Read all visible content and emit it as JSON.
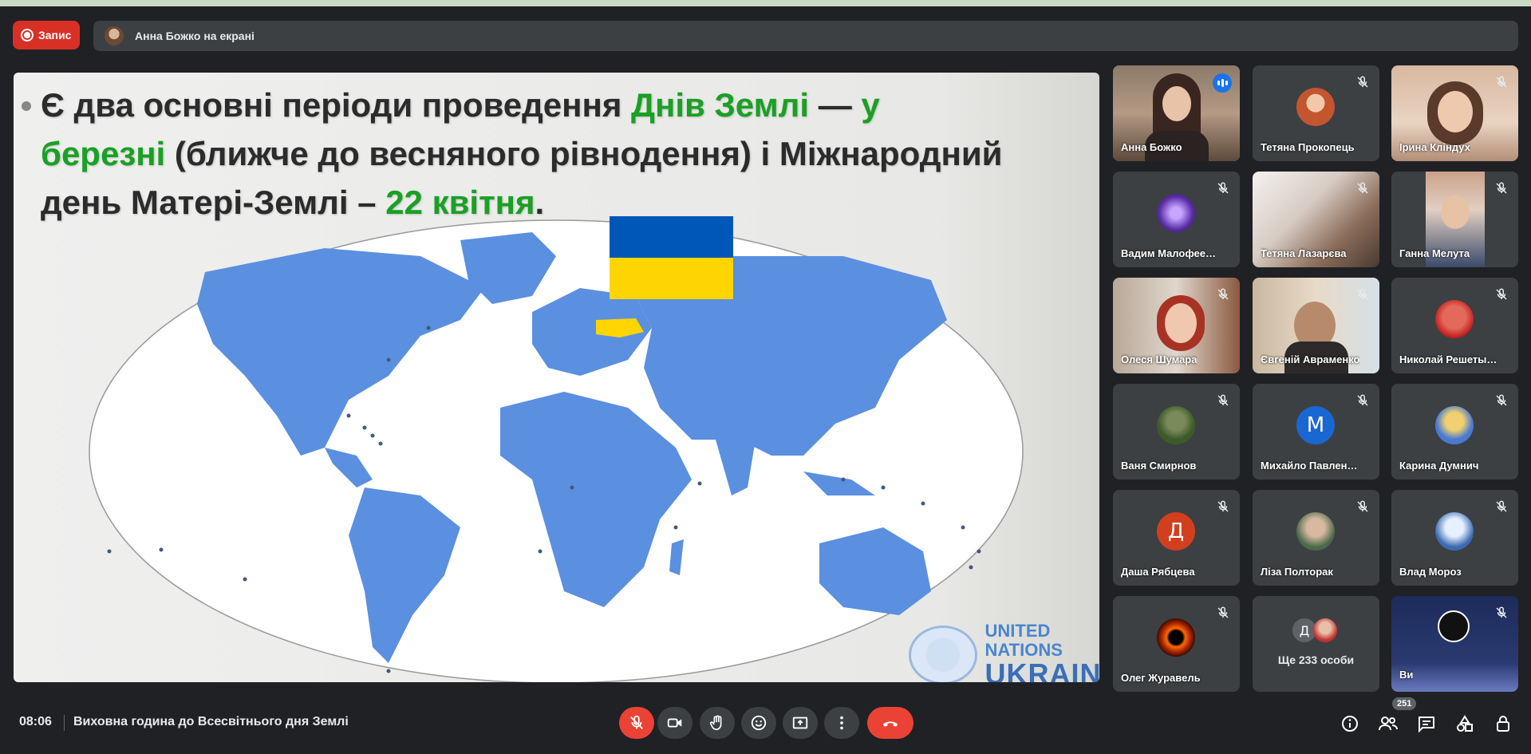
{
  "recording": {
    "label": "Запис"
  },
  "presenter_bar": {
    "text": "Анна Божко на екрані"
  },
  "slide": {
    "line1_a": "Є два основні періоди проведення ",
    "line1_b": "Днів Землі",
    "line1_c": " — ",
    "line1_d": "у",
    "line2_a": "березні",
    "line2_b": " (ближче до весняного рівнодення) і Міжнародний",
    "line3_a": "день Матері-Землі – ",
    "line3_b": "22 квітня",
    "line3_c": ".",
    "logo_line1": "UNITED NATIONS",
    "logo_line2": "UKRAINE"
  },
  "participants": [
    {
      "name": "Анна Божко",
      "kind": "video",
      "active": true
    },
    {
      "name": "Тетяна Прокопець",
      "kind": "avatar-photo",
      "muted": true
    },
    {
      "name": "Ірина Кліндух",
      "kind": "video",
      "muted": true
    },
    {
      "name": "Вадим Малофее…",
      "kind": "avatar-photo",
      "muted": true
    },
    {
      "name": "Тетяна Лазарєва",
      "kind": "video",
      "muted": true
    },
    {
      "name": "Ганна Мелута",
      "kind": "video",
      "muted": true
    },
    {
      "name": "Олеся Шумара",
      "kind": "video",
      "muted": true
    },
    {
      "name": "Євгеній Авраменко",
      "kind": "video",
      "muted": true
    },
    {
      "name": "Николай Решеты…",
      "kind": "avatar-photo",
      "muted": true
    },
    {
      "name": "Ваня Смирнов",
      "kind": "avatar-photo",
      "muted": true
    },
    {
      "name": "Михайло Павлен…",
      "kind": "letter",
      "letter": "М",
      "muted": true
    },
    {
      "name": "Карина Думнич",
      "kind": "avatar-photo",
      "muted": true
    },
    {
      "name": "Даша Рябцева",
      "kind": "letter",
      "letter": "Д",
      "muted": true
    },
    {
      "name": "Ліза Полторак",
      "kind": "avatar-photo",
      "muted": true
    },
    {
      "name": "Влад Мороз",
      "kind": "avatar-photo",
      "muted": true
    },
    {
      "name": "Олег Журавель",
      "kind": "avatar-photo",
      "muted": true
    },
    {
      "name": "Ще 233 особи",
      "kind": "more",
      "letter": "Д"
    },
    {
      "name": "Ви",
      "kind": "self",
      "muted": true
    }
  ],
  "bottom": {
    "time": "08:06",
    "title": "Виховна година до Всесвітнього дня Землі",
    "people_count": "251"
  },
  "colors": {
    "accent": "#8ab4f8",
    "danger": "#ea4335",
    "record": "#d93025",
    "map_land": "#5b8fe0",
    "flag_blue": "#0057b7",
    "flag_yellow": "#ffd700"
  },
  "icons": [
    "record-icon",
    "mic-off-icon",
    "camera-icon",
    "raise-hand-icon",
    "emoji-icon",
    "present-icon",
    "more-icon",
    "end-call-icon",
    "info-icon",
    "people-icon",
    "chat-icon",
    "activities-icon",
    "host-controls-icon"
  ]
}
